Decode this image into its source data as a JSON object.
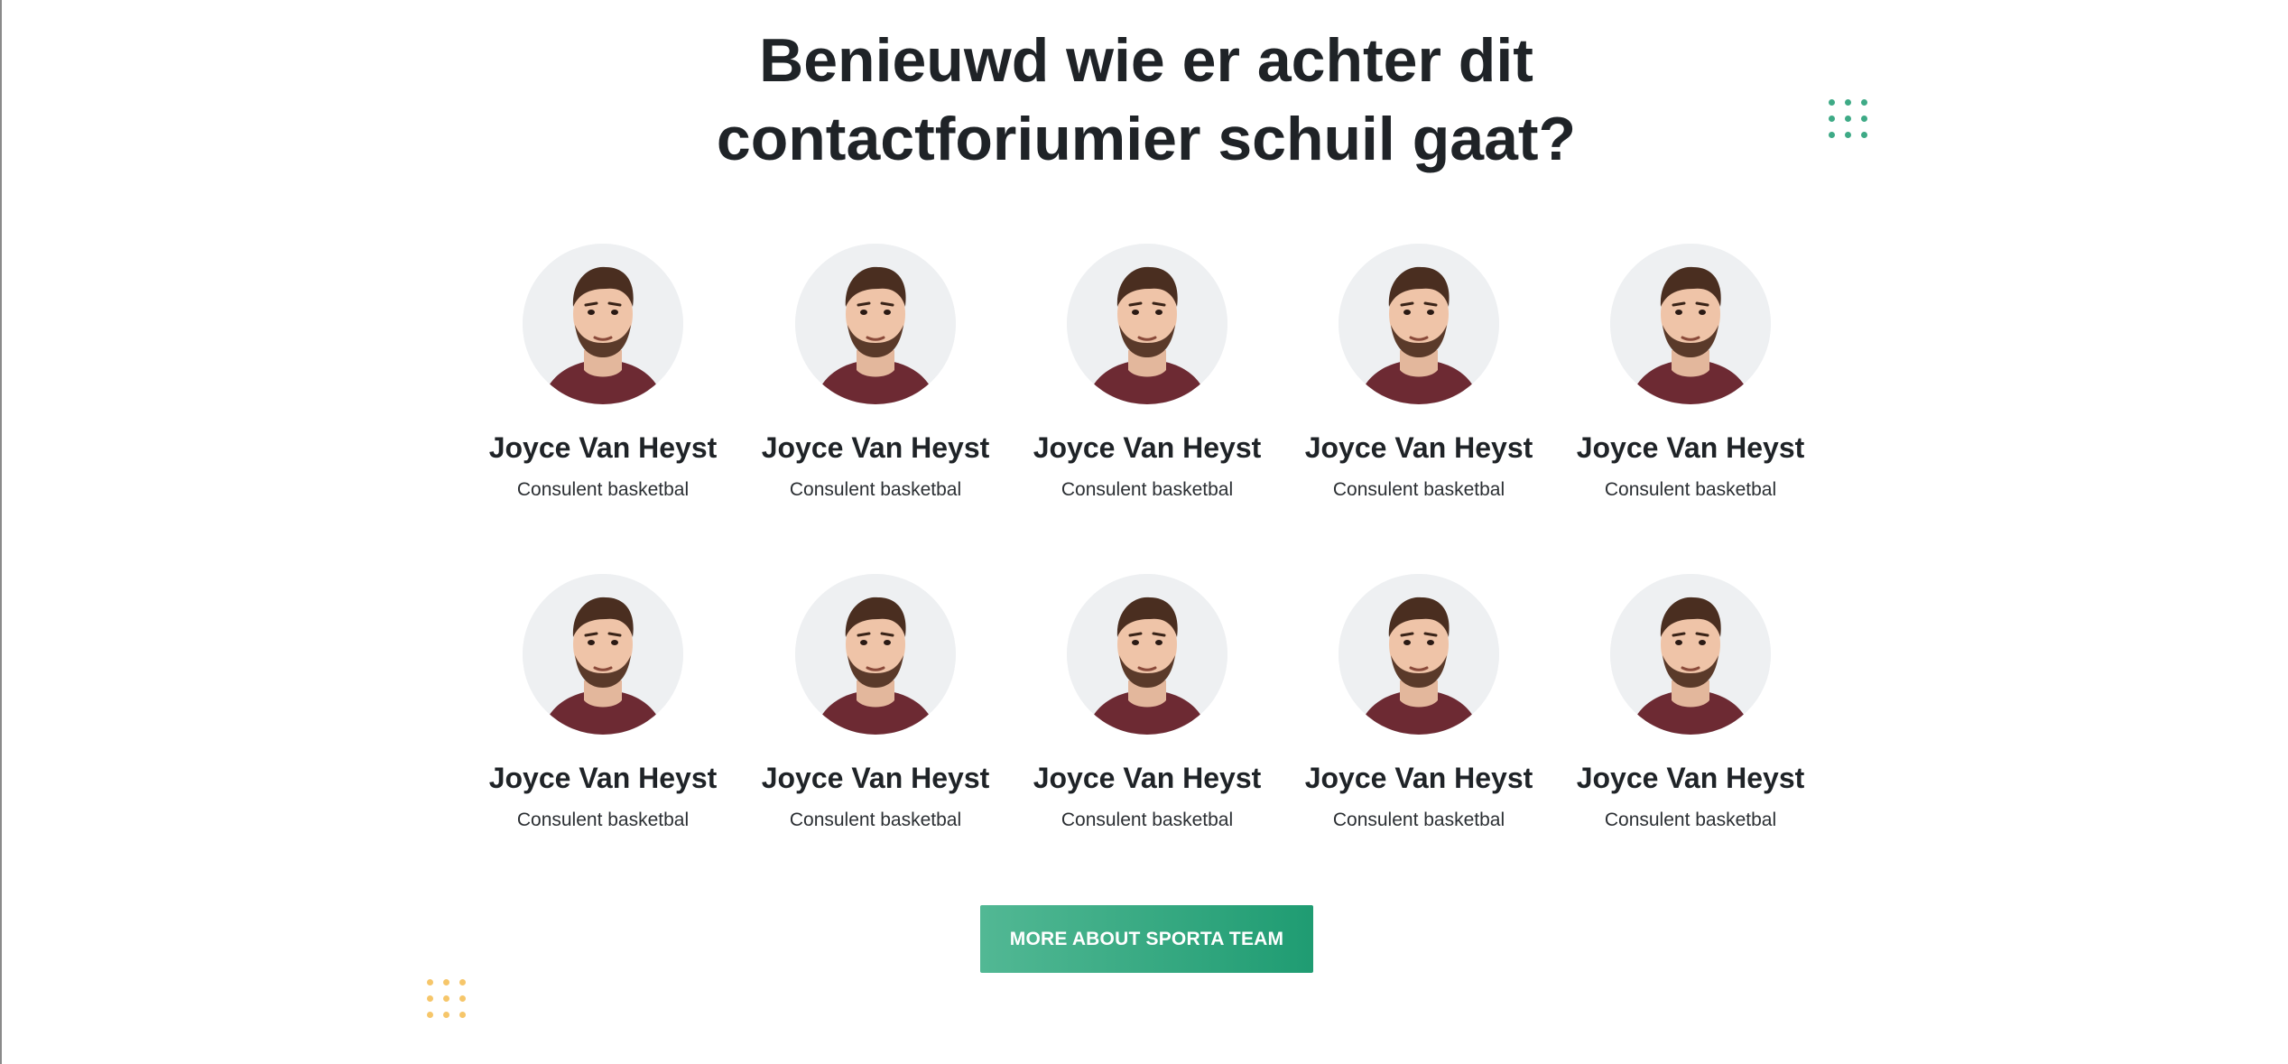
{
  "section": {
    "title_line1": "Benieuwd wie er achter dit",
    "title_line2": "contactforiumier schuil gaat?"
  },
  "team": {
    "members": [
      {
        "name": "Joyce Van Heyst",
        "role": "Consulent basketbal"
      },
      {
        "name": "Joyce Van Heyst",
        "role": "Consulent basketbal"
      },
      {
        "name": "Joyce Van Heyst",
        "role": "Consulent basketbal"
      },
      {
        "name": "Joyce Van Heyst",
        "role": "Consulent basketbal"
      },
      {
        "name": "Joyce Van Heyst",
        "role": "Consulent basketbal"
      },
      {
        "name": "Joyce Van Heyst",
        "role": "Consulent basketbal"
      },
      {
        "name": "Joyce Van Heyst",
        "role": "Consulent basketbal"
      },
      {
        "name": "Joyce Van Heyst",
        "role": "Consulent basketbal"
      },
      {
        "name": "Joyce Van Heyst",
        "role": "Consulent basketbal"
      },
      {
        "name": "Joyce Van Heyst",
        "role": "Consulent basketbal"
      }
    ]
  },
  "cta": {
    "label": "MORE ABOUT SPORTA TEAM"
  },
  "colors": {
    "accent_green": "#3eaa86",
    "decor_yellow": "#f6c66a",
    "heading": "#1f2327"
  },
  "icons": {
    "avatar": "person-portrait-icon",
    "decor_top_right": "dot-grid-icon",
    "decor_bottom_left": "dot-grid-icon"
  }
}
